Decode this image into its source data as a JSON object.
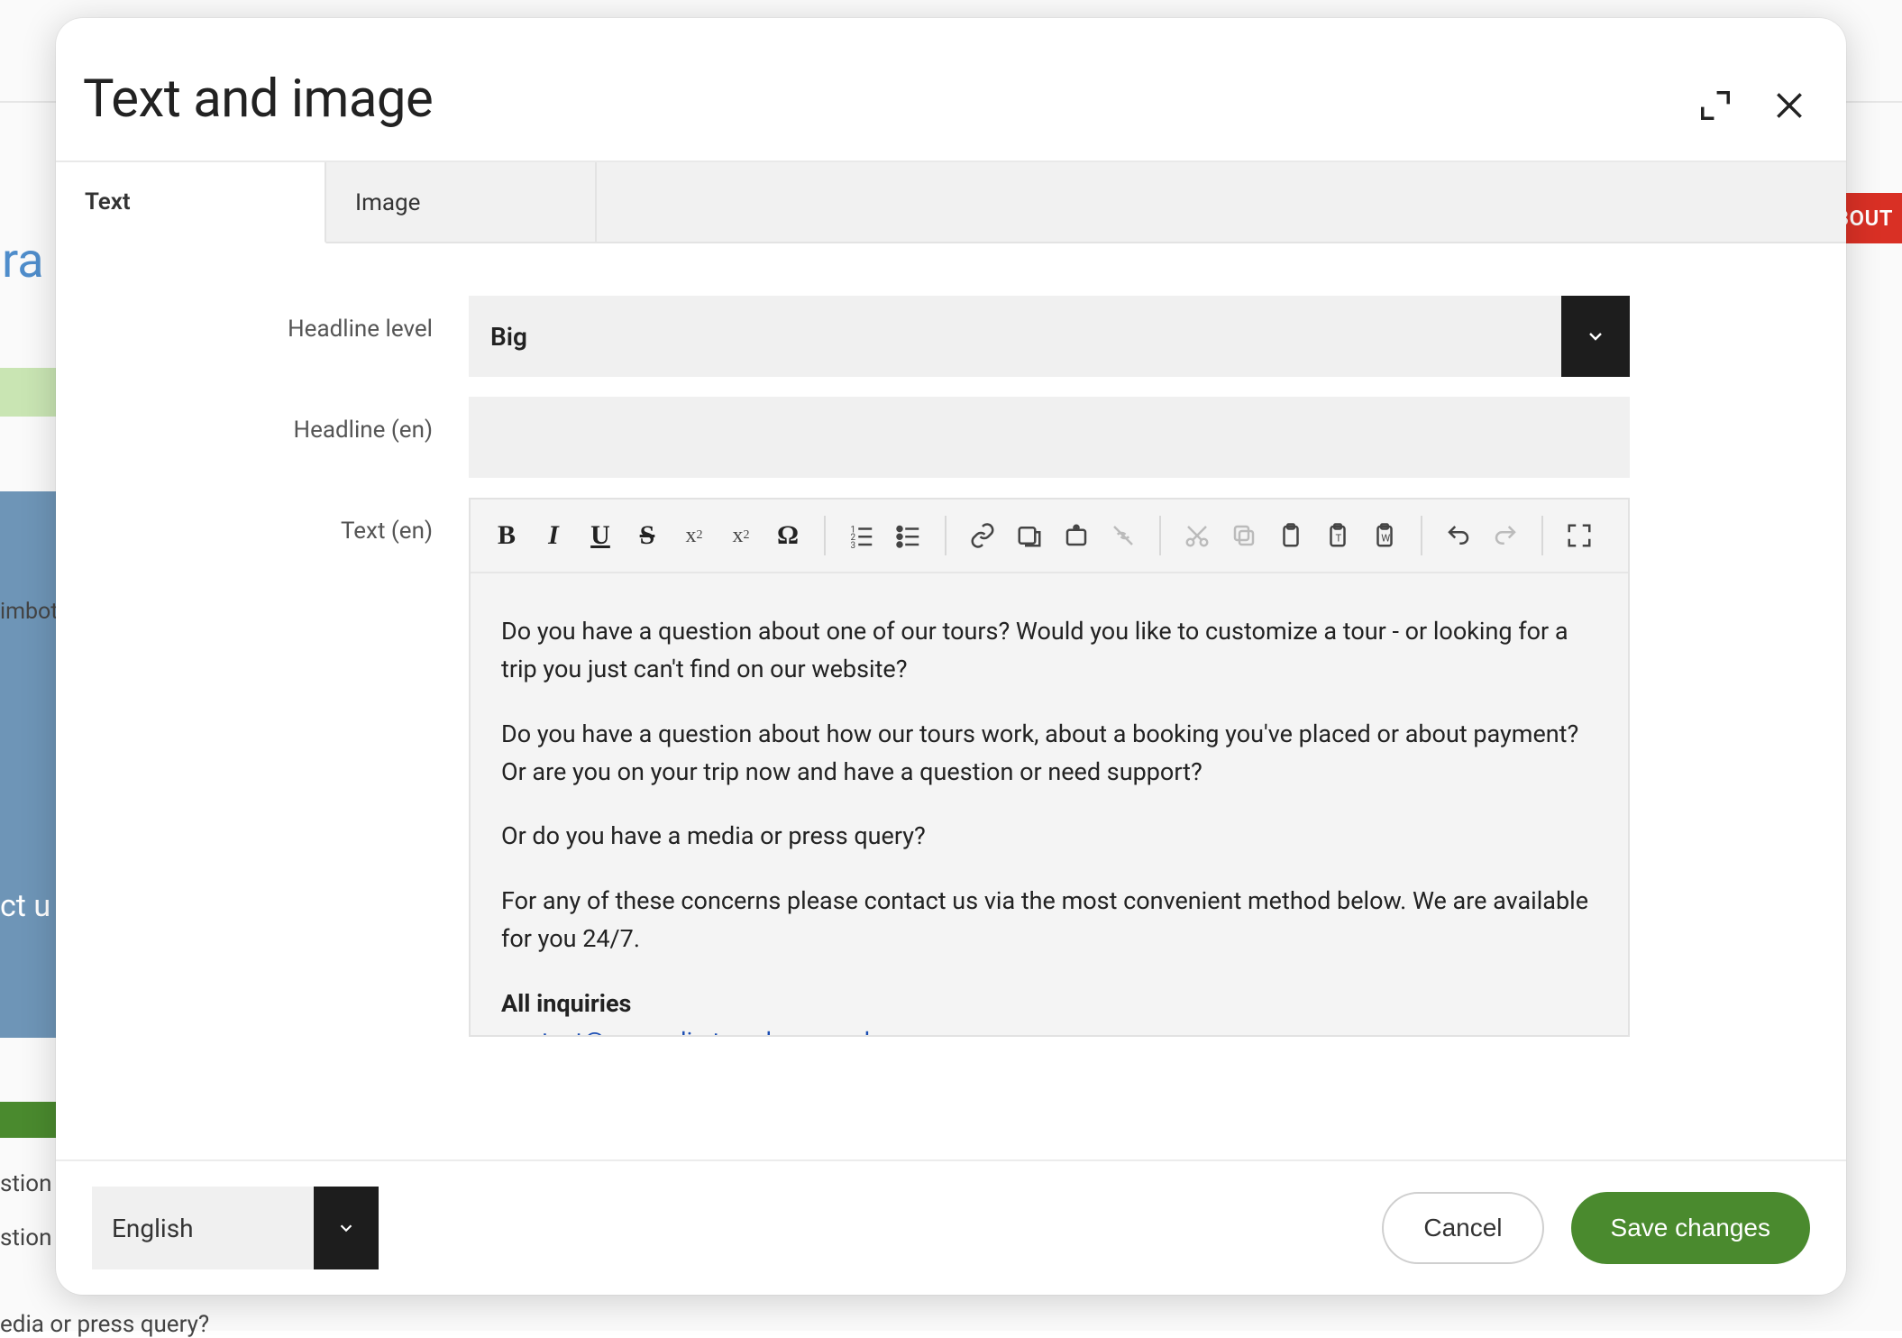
{
  "background": {
    "nav_about": "BOUT",
    "logo_fragment": "ra",
    "jumbot_fragment": "imbot",
    "hero_text_fragment": "ct u",
    "sub1": "stion",
    "sub2": "stion",
    "sub3": "edia or press query?"
  },
  "dialog": {
    "title": "Text and image",
    "tabs": [
      {
        "label": "Text",
        "active": true
      },
      {
        "label": "Image",
        "active": false
      }
    ],
    "fields": {
      "headline_level": {
        "label": "Headline level",
        "value": "Big"
      },
      "headline_en": {
        "label": "Headline (en)",
        "value": ""
      },
      "text_en": {
        "label": "Text (en)"
      }
    },
    "editor_content": {
      "p1": "Do you have a question about one of our tours? Would you like to customize a tour - or looking for a trip you just can't find on our website?",
      "p2": "Do you have a question about how our tours work, about a booking you've placed or about payment? Or are you on your trip now and have a question or need support?",
      "p3": "Or do you have a media or press query?",
      "p4": "For any of these concerns please contact us via the most convenient method below. We are available for you 24/7.",
      "inquiries_heading": "All inquiries",
      "inquiries_email": "contact@magnolia-travels-example.com"
    },
    "footer": {
      "language": "English",
      "cancel": "Cancel",
      "save": "Save changes"
    }
  }
}
